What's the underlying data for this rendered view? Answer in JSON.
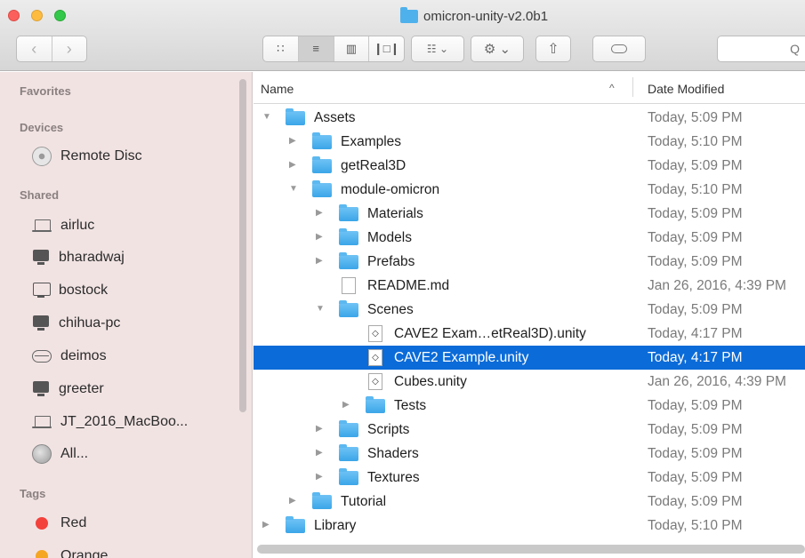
{
  "window": {
    "title": "omicron-unity-v2.0b1"
  },
  "toolbar": {
    "back": "‹",
    "forward": "›",
    "view_icons": [
      "∷",
      "≡",
      "▥",
      "❙□❙"
    ],
    "arrange_icon": "☷ ⌄",
    "action_icon": "⚙ ⌄",
    "share_icon": "⇧",
    "search_icon": "Q"
  },
  "sidebar": {
    "favorites_label": "Favorites",
    "devices_label": "Devices",
    "shared_label": "Shared",
    "tags_label": "Tags",
    "devices": [
      {
        "label": "Remote Disc",
        "icon": "disc-icon"
      }
    ],
    "shared": [
      {
        "label": "airluc",
        "icon": "laptop-icon"
      },
      {
        "label": "bharadwaj",
        "icon": "monitor-icon"
      },
      {
        "label": "bostock",
        "icon": "monitor-icon"
      },
      {
        "label": "chihua-pc",
        "icon": "monitor-icon"
      },
      {
        "label": "deimos",
        "icon": "drive-icon"
      },
      {
        "label": "greeter",
        "icon": "monitor-icon"
      },
      {
        "label": "JT_2016_MacBoo...",
        "icon": "laptop-icon"
      },
      {
        "label": "All...",
        "icon": "globe-icon"
      }
    ],
    "tags": [
      {
        "label": "Red",
        "color": "#f3413b"
      },
      {
        "label": "Orange",
        "color": "#f5a623"
      }
    ]
  },
  "list": {
    "col_name": "Name",
    "col_date": "Date Modified",
    "sort_indicator": "^",
    "rows": [
      {
        "name": "Assets",
        "date": "Today, 5:09 PM",
        "type": "folder",
        "depth": 0,
        "expanded": true
      },
      {
        "name": "Examples",
        "date": "Today, 5:10 PM",
        "type": "folder",
        "depth": 1,
        "expanded": false
      },
      {
        "name": "getReal3D",
        "date": "Today, 5:09 PM",
        "type": "folder",
        "depth": 1,
        "expanded": false
      },
      {
        "name": "module-omicron",
        "date": "Today, 5:10 PM",
        "type": "folder",
        "depth": 1,
        "expanded": true
      },
      {
        "name": "Materials",
        "date": "Today, 5:09 PM",
        "type": "folder",
        "depth": 2,
        "expanded": false
      },
      {
        "name": "Models",
        "date": "Today, 5:09 PM",
        "type": "folder",
        "depth": 2,
        "expanded": false
      },
      {
        "name": "Prefabs",
        "date": "Today, 5:09 PM",
        "type": "folder",
        "depth": 2,
        "expanded": false
      },
      {
        "name": "README.md",
        "date": "Jan 26, 2016, 4:39 PM",
        "type": "file",
        "depth": 2
      },
      {
        "name": "Scenes",
        "date": "Today, 5:09 PM",
        "type": "folder",
        "depth": 2,
        "expanded": true
      },
      {
        "name": "CAVE2 Exam…etReal3D).unity",
        "date": "Today, 4:17 PM",
        "type": "unity",
        "depth": 3
      },
      {
        "name": "CAVE2 Example.unity",
        "date": "Today, 4:17 PM",
        "type": "unity",
        "depth": 3,
        "selected": true
      },
      {
        "name": "Cubes.unity",
        "date": "Jan 26, 2016, 4:39 PM",
        "type": "unity",
        "depth": 3
      },
      {
        "name": "Tests",
        "date": "Today, 5:09 PM",
        "type": "folder",
        "depth": 3,
        "expanded": false
      },
      {
        "name": "Scripts",
        "date": "Today, 5:09 PM",
        "type": "folder",
        "depth": 2,
        "expanded": false
      },
      {
        "name": "Shaders",
        "date": "Today, 5:09 PM",
        "type": "folder",
        "depth": 2,
        "expanded": false
      },
      {
        "name": "Textures",
        "date": "Today, 5:09 PM",
        "type": "folder",
        "depth": 2,
        "expanded": false
      },
      {
        "name": "Tutorial",
        "date": "Today, 5:09 PM",
        "type": "folder",
        "depth": 1,
        "expanded": false
      },
      {
        "name": "Library",
        "date": "Today, 5:10 PM",
        "type": "folder",
        "depth": 0,
        "expanded": false
      }
    ]
  },
  "colors": {
    "selection": "#0b6bd8",
    "folder": "#4fb1ec",
    "sidebar_bg": "#f2e3e3"
  }
}
